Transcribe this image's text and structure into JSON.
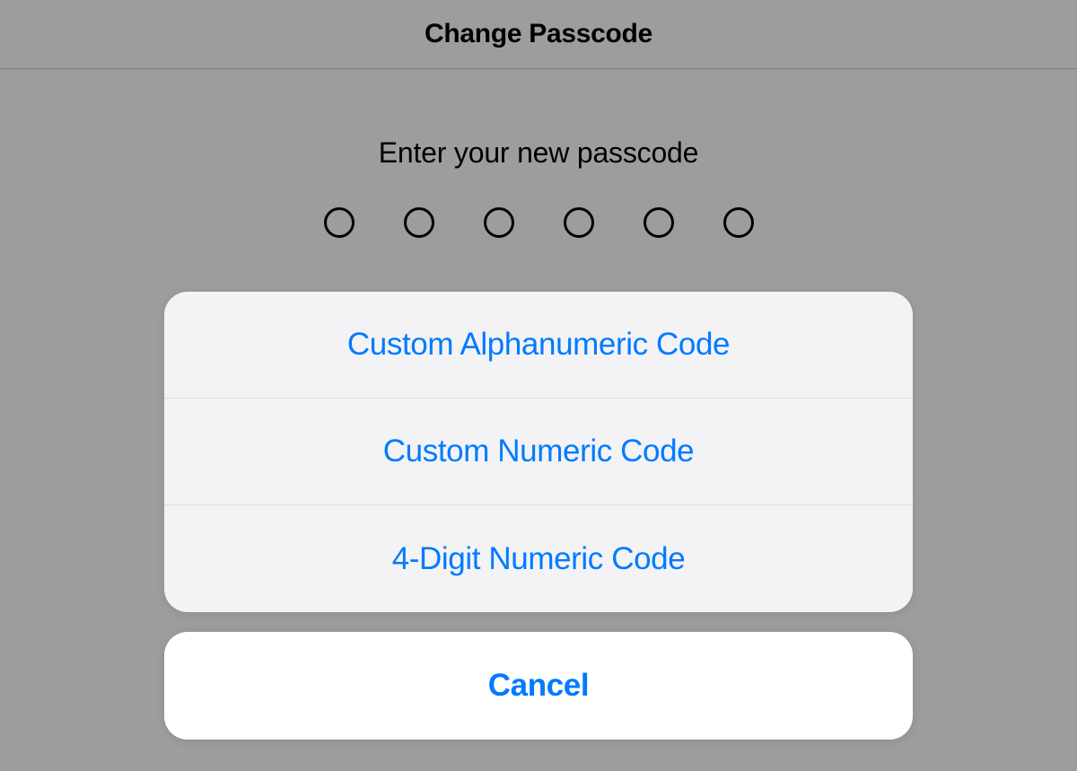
{
  "header": {
    "title": "Change Passcode"
  },
  "instruction": "Enter your new passcode",
  "passcode": {
    "digit_count": 6
  },
  "action_sheet": {
    "options": [
      {
        "label": "Custom Alphanumeric Code"
      },
      {
        "label": "Custom Numeric Code"
      },
      {
        "label": "4-Digit Numeric Code"
      }
    ],
    "cancel_label": "Cancel"
  },
  "colors": {
    "accent": "#007aff",
    "background_dimmed": "#9d9d9d",
    "sheet_background": "#f3f3f5",
    "cancel_background": "#ffffff"
  }
}
